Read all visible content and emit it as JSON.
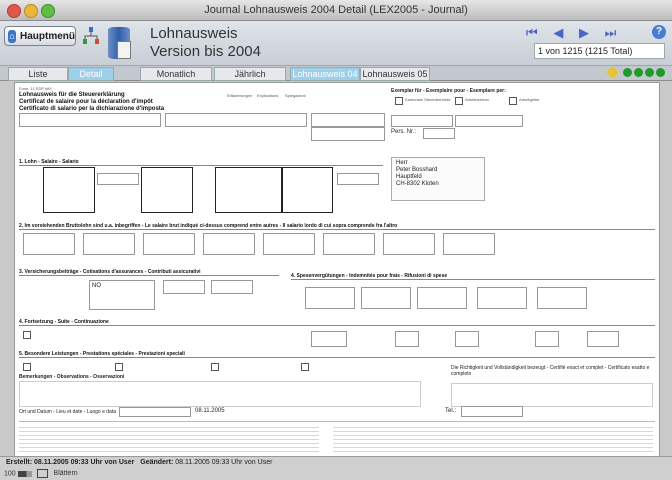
{
  "window": {
    "title": "Journal Lohnausweis 2004 Detail (LEX2005 - Journal)"
  },
  "header": {
    "menu_label": "Hauptmenü",
    "title_line1": "Lohnausweis",
    "title_line2": "Version bis 2004",
    "record_count": "1 von 1215 (1215 Total)"
  },
  "tabs": [
    {
      "label": "Liste"
    },
    {
      "label": "Detail"
    },
    {
      "label": "Monatlich"
    },
    {
      "label": "Jährlich"
    },
    {
      "label": "Lohnausweis 04"
    },
    {
      "label": "Lohnausweis 05"
    }
  ],
  "form": {
    "form_no": "Form. 11 EDP d/f/i",
    "title_de": "Lohnausweis für die Steuererklärung",
    "title_fr": "Certificat de salaire pour la déclaration d'impôt",
    "title_it": "Certificato di salario per la dichiarazione d'imposta",
    "top_labels": [
      "Erläuterungen",
      "Explications",
      "Spiegazioni"
    ],
    "copies_title": "Exemplar für - Exemplaire pour - Esemplare per:",
    "copies": [
      "Kantonale Steuerbehörde",
      "Arbeitnehmer",
      "Arbeitgeber"
    ],
    "pers_nr_label": "Pers. Nr.:",
    "address": [
      "Herr",
      "Peter Bosshard",
      "Hauptfeld",
      "CH-8302 Kloten"
    ],
    "section1": "1. Lohn - Salaire - Salario",
    "section2": "2. Im vorstehenden Bruttolohn sind u.a. inbegriffen - Le salaire brut indiqué ci-dessus comprend entre autres - Il salario lordo di cui sopra comprende fra l'altro",
    "section3": "3. Versicherungsbeiträge - Cotisations d'assurances - Contributi assicurativi",
    "section4": "4. Spesenvergütungen - Indemnités pour frais - Rifusioni di spese",
    "section4b": "4. Fortsetzung - Suite - Continuazione",
    "section5": "5. Besondere Leistungen - Prestations spéciales - Prestazioni speciali",
    "remarks": "Bemerkungen - Observations - Osservazioni",
    "ahv_value": "NO",
    "place_date_label": "Ort und Datum - Lieu et date - Luogo e data",
    "place_date_value": "08.11.2005",
    "right_note": "Die Richtigkeit und Vollständigkeit bezeugt - Certifié exact et complet - Certificato esatto e completo",
    "tel_label": "Tel.:"
  },
  "status": {
    "created": "Erstellt: 08.11.2005 09:33 Uhr von User",
    "changed_label": "Geändert:",
    "changed": "08.11.2005 09:33 Uhr von User",
    "zoom": "100",
    "mode": "Blättern"
  }
}
